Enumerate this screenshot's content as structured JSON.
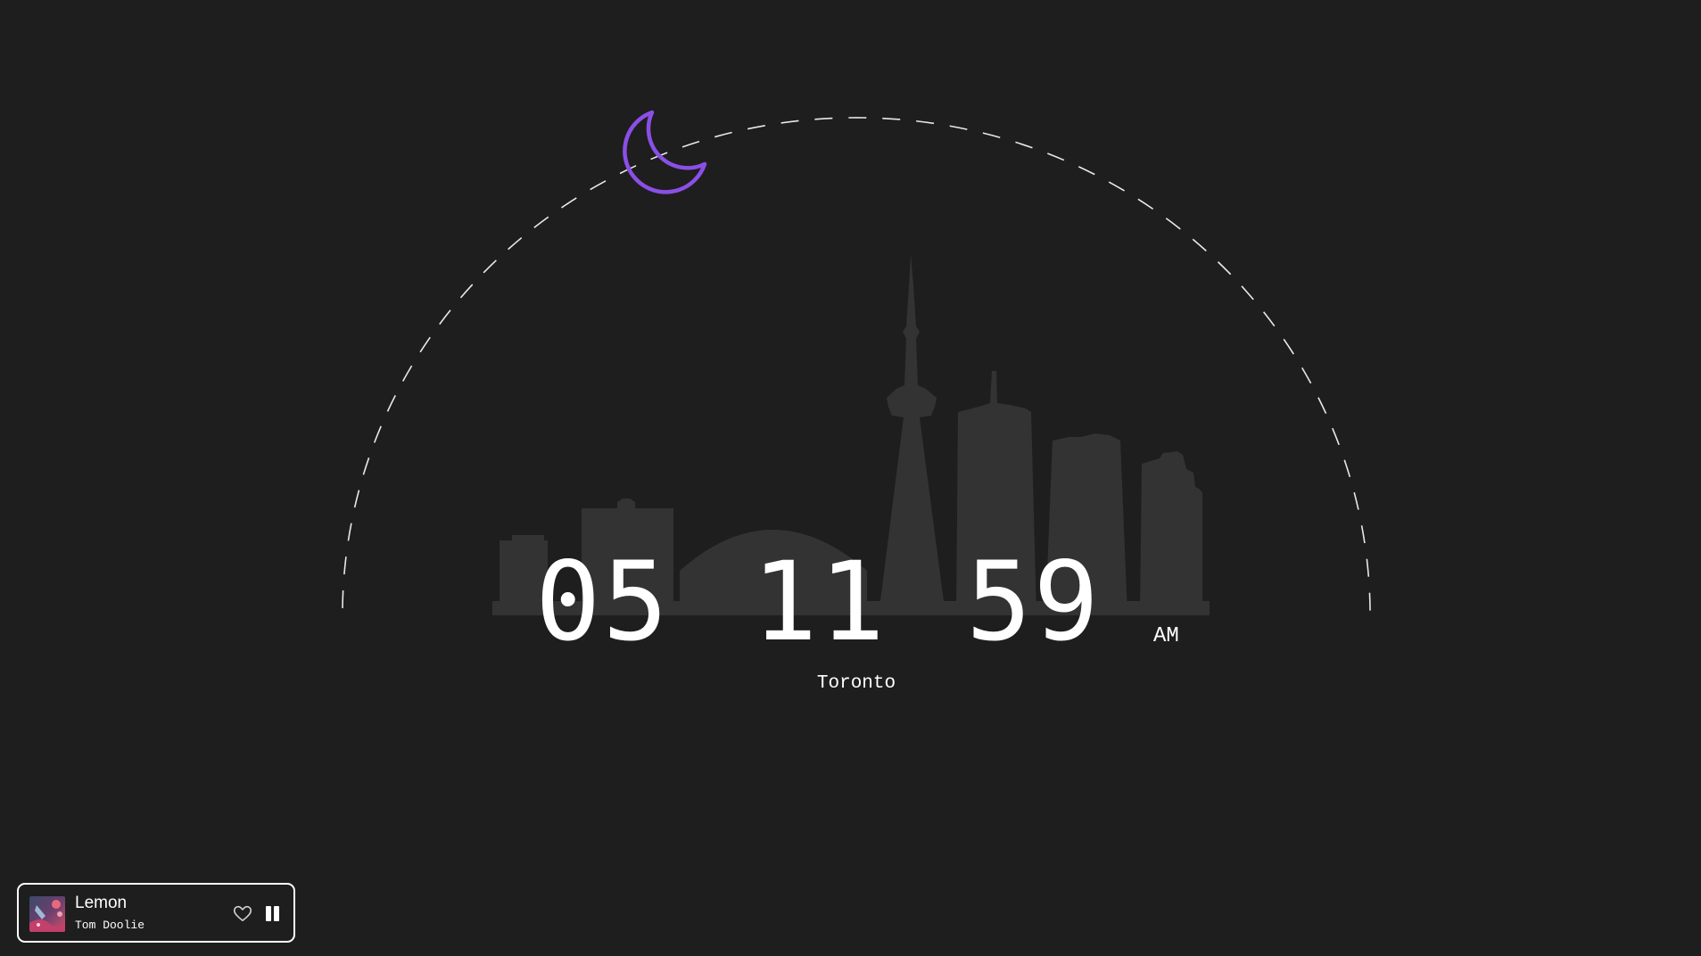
{
  "clock": {
    "hours": "05",
    "minutes": "11",
    "seconds": "59",
    "period": "AM",
    "city": "Toronto"
  },
  "scene": {
    "celestial_icon": "moon-icon",
    "moon_color": "#8b4fe6",
    "arc_color": "#ffffff",
    "skyline_color": "#333333",
    "background_color": "#1e1e1e"
  },
  "player": {
    "track_title": "Lemon",
    "artist": "Tom Doolie",
    "like_icon": "heart-icon",
    "pause_icon": "pause-icon",
    "border_color": "#ffffff"
  }
}
